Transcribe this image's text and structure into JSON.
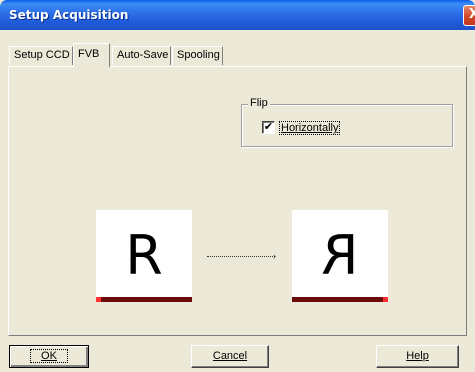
{
  "window": {
    "title": "Setup Acquisition",
    "close_glyph": "X"
  },
  "tabs": [
    {
      "label": "Setup CCD",
      "active": false
    },
    {
      "label": "FVB",
      "active": true
    },
    {
      "label": "Auto-Save",
      "active": false
    },
    {
      "label": "Spooling",
      "active": false
    }
  ],
  "flip": {
    "group_label": "Flip",
    "checkbox_checked": true,
    "check_glyph": "✔",
    "checkbox_label": "Horizontally"
  },
  "preview": {
    "original_glyph": "R",
    "flipped_glyph": "R",
    "arrow_glyph": "›",
    "bar_color": "#6b0b0b",
    "bar_end_color": "#ff3030"
  },
  "buttons": {
    "ok": "OK",
    "cancel": "Cancel",
    "help": "Help"
  }
}
